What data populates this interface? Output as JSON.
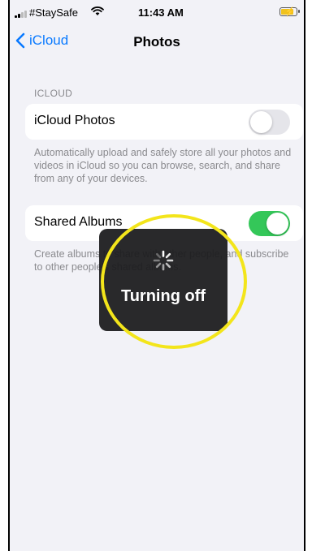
{
  "status_bar": {
    "carrier": "#StaySafe",
    "time": "11:43 AM"
  },
  "nav": {
    "back_label": "iCloud",
    "title": "Photos"
  },
  "section": {
    "header": "ICLOUD"
  },
  "settings": {
    "icloud_photos": {
      "label": "iCloud Photos",
      "enabled": false,
      "description": "Automatically upload and safely store all your photos and videos in iCloud so you can browse, search, and share from any of your devices."
    },
    "shared_albums": {
      "label": "Shared Albums",
      "enabled": true,
      "description": "Create albums to share with other people, and subscribe to other people's shared albums."
    }
  },
  "hud": {
    "label": "Turning off"
  },
  "colors": {
    "accent": "#0a7aff",
    "toggle_on": "#34c759",
    "highlight": "#f3e51b",
    "hud_bg": "#1c1c1e"
  }
}
